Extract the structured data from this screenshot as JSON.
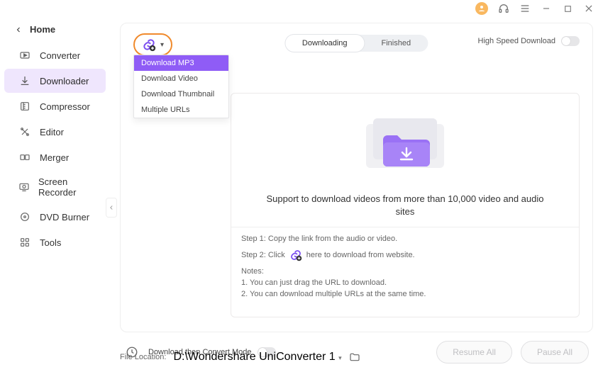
{
  "titlebar": {
    "user_icon": "user-avatar"
  },
  "home_label": "Home",
  "sidebar": {
    "items": [
      {
        "label": "Converter"
      },
      {
        "label": "Downloader",
        "active": true
      },
      {
        "label": "Compressor"
      },
      {
        "label": "Editor"
      },
      {
        "label": "Merger"
      },
      {
        "label": "Screen Recorder"
      },
      {
        "label": "DVD Burner"
      },
      {
        "label": "Tools"
      }
    ]
  },
  "tabs": {
    "downloading": "Downloading",
    "finished": "Finished"
  },
  "high_speed_label": "High Speed Download",
  "dropdown": {
    "items": [
      "Download MP3",
      "Download Video",
      "Download Thumbnail",
      "Multiple URLs"
    ]
  },
  "content": {
    "caption": "Support to download videos from more than 10,000 video and audio sites",
    "step1": "Step 1: Copy the link from the audio or video.",
    "step2a": "Step 2: Click",
    "step2b": "here to download from website.",
    "notes_label": "Notes:",
    "note1": "1. You can just drag the URL to download.",
    "note2": "2. You can download multiple URLs at the same time."
  },
  "footer": {
    "mode_label": "Download then Convert Mode",
    "loc_label": "File Location:",
    "loc_value": "D:\\Wondershare UniConverter 1",
    "resume": "Resume All",
    "pause": "Pause All"
  },
  "colors": {
    "accent": "#8f5cf6",
    "highlight_border": "#f08a2c"
  }
}
